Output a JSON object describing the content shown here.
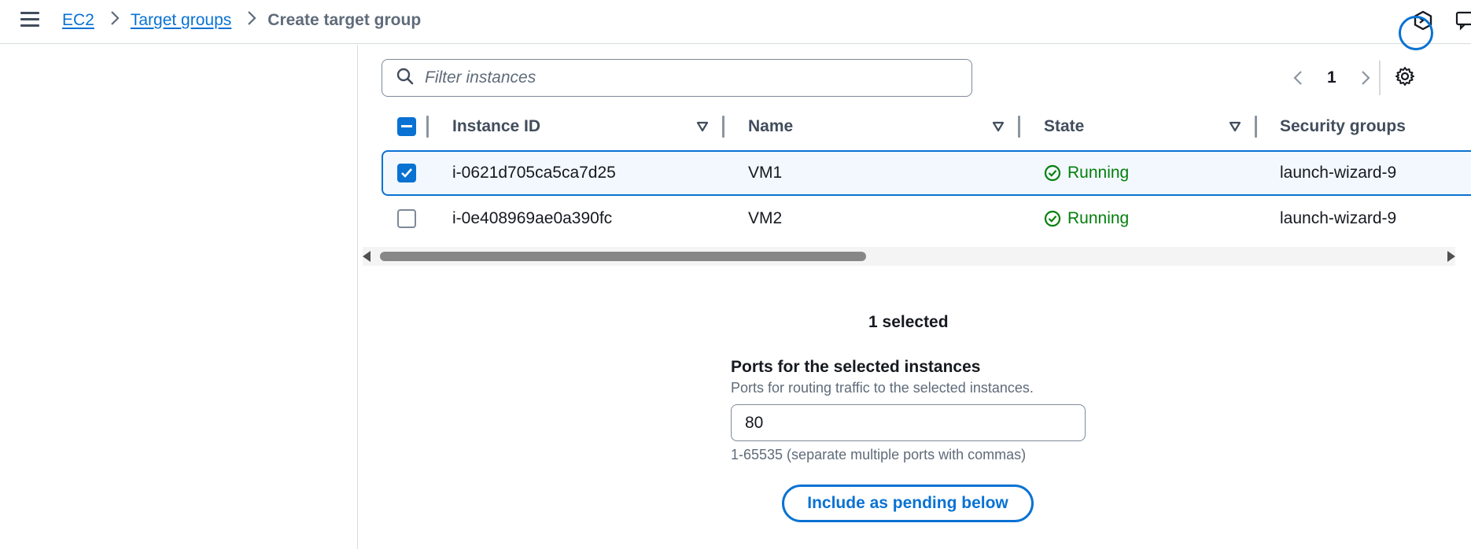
{
  "breadcrumb": {
    "items": [
      {
        "label": "EC2"
      },
      {
        "label": "Target groups"
      }
    ],
    "current": "Create target group"
  },
  "filter": {
    "placeholder": "Filter instances"
  },
  "pagination": {
    "current_page": "1"
  },
  "table": {
    "columns": [
      "Instance ID",
      "Name",
      "State",
      "Security groups"
    ],
    "rows": [
      {
        "instance_id": "i-0621d705ca5ca7d25",
        "name": "VM1",
        "state": "Running",
        "security_groups": "launch-wizard-9",
        "selected": true
      },
      {
        "instance_id": "i-0e408969ae0a390fc",
        "name": "VM2",
        "state": "Running",
        "security_groups": "launch-wizard-9",
        "selected": false
      }
    ]
  },
  "selection": {
    "count_text": "1 selected"
  },
  "ports": {
    "label": "Ports for the selected instances",
    "description": "Ports for routing traffic to the selected instances.",
    "value": "80",
    "hint": "1-65535 (separate multiple ports with commas)"
  },
  "actions": {
    "include_pending_label": "Include as pending below"
  },
  "colors": {
    "accent": "#0972d3",
    "success": "#037f0c"
  }
}
